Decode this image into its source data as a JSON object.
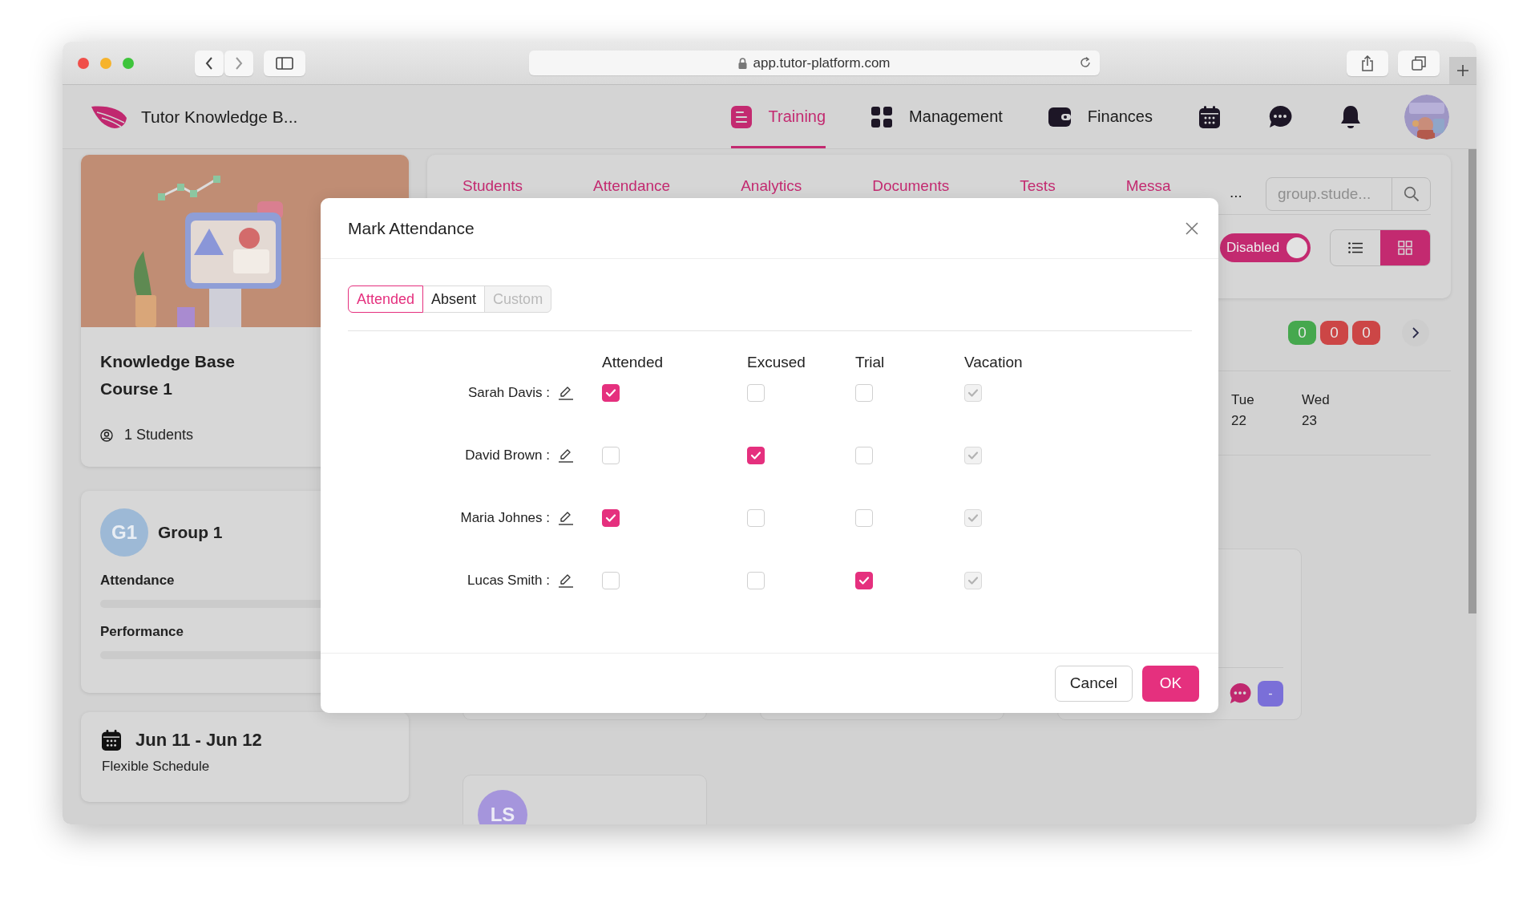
{
  "browser": {
    "url": "app.tutor-platform.com"
  },
  "header": {
    "brand": "Tutor Knowledge B...",
    "nav": [
      {
        "label": "Training",
        "selected": true
      },
      {
        "label": "Management",
        "selected": false
      },
      {
        "label": "Finances",
        "selected": false
      }
    ]
  },
  "course_card": {
    "title": "Knowledge Base Course 1",
    "students": "1 Students"
  },
  "group_card": {
    "avatar": "G1",
    "name": "Group 1",
    "metrics": [
      {
        "label": "Attendance",
        "level": 0
      },
      {
        "label": "Performance",
        "level": 0
      }
    ]
  },
  "schedule_card": {
    "dates": "Jun 11 - Jun 12",
    "note": "Flexible Schedule"
  },
  "section_tabs": [
    "Students",
    "Attendance",
    "Analytics",
    "Documents",
    "Tests",
    "Messa"
  ],
  "more": "...",
  "search": {
    "placeholder": "group.stude..."
  },
  "toggle": {
    "label": "Disabled",
    "on": true
  },
  "view_modes": [
    {
      "kind": "list",
      "selected": false
    },
    {
      "kind": "grid",
      "selected": true
    }
  ],
  "counters": [
    {
      "value": "0",
      "color": "#46a84e"
    },
    {
      "value": "0",
      "color": "#cc4646"
    },
    {
      "value": "0",
      "color": "#cc4646"
    }
  ],
  "days": [
    {
      "weekday": "Tue",
      "date": "22"
    },
    {
      "weekday": "Wed",
      "date": "23"
    }
  ],
  "lesson_card": {
    "badge": "-"
  },
  "student_card": {
    "avatar": "LS"
  },
  "modal": {
    "title": "Mark Attendance",
    "modes": [
      {
        "label": "Attended",
        "selected": true,
        "disabled": false
      },
      {
        "label": "Absent",
        "selected": false,
        "disabled": false
      },
      {
        "label": "Custom",
        "selected": false,
        "disabled": true
      }
    ],
    "columns": [
      "Attended",
      "Excused",
      "Trial",
      "Vacation"
    ],
    "rows": [
      {
        "name": "Sarah Davis :",
        "marks": [
          {
            "checked": true,
            "disabled": false
          },
          {
            "checked": false,
            "disabled": false
          },
          {
            "checked": false,
            "disabled": false
          },
          {
            "checked": true,
            "disabled": true
          }
        ]
      },
      {
        "name": "David Brown :",
        "marks": [
          {
            "checked": false,
            "disabled": false
          },
          {
            "checked": true,
            "disabled": false
          },
          {
            "checked": false,
            "disabled": false
          },
          {
            "checked": true,
            "disabled": true
          }
        ]
      },
      {
        "name": "Maria Johnes :",
        "marks": [
          {
            "checked": true,
            "disabled": false
          },
          {
            "checked": false,
            "disabled": false
          },
          {
            "checked": false,
            "disabled": false
          },
          {
            "checked": true,
            "disabled": true
          }
        ]
      },
      {
        "name": "Lucas Smith :",
        "marks": [
          {
            "checked": false,
            "disabled": false
          },
          {
            "checked": false,
            "disabled": false
          },
          {
            "checked": true,
            "disabled": false
          },
          {
            "checked": true,
            "disabled": true
          }
        ]
      }
    ],
    "buttons": [
      {
        "label": "Cancel",
        "kind": "default"
      },
      {
        "label": "OK",
        "kind": "primary"
      }
    ]
  }
}
